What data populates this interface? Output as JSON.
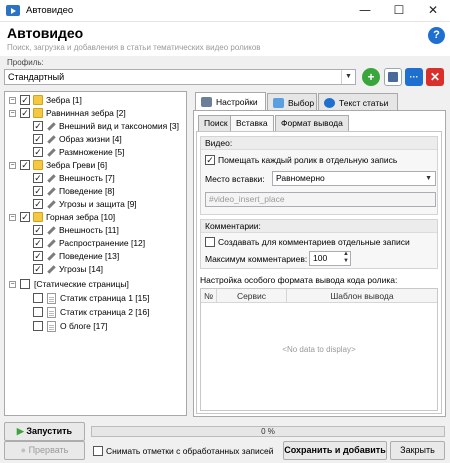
{
  "window": {
    "title": "Автовидео",
    "minimize": "—",
    "maximize": "☐",
    "close": "✕"
  },
  "header": {
    "title": "Автовидео",
    "subtitle": "Поиск, загрузка и добавления в статьи тематических видео роликов",
    "help": "?"
  },
  "profile": {
    "label": "Профиль:",
    "value": "Стандартный"
  },
  "tree": [
    {
      "label": "Зебра [1]"
    },
    {
      "label": "Равнинная зебра [2]"
    },
    {
      "label": "Внешний вид и таксономия [3]"
    },
    {
      "label": "Образ жизни [4]"
    },
    {
      "label": "Размножение [5]"
    },
    {
      "label": "Зебра Греви [6]"
    },
    {
      "label": "Внешность [7]"
    },
    {
      "label": "Поведение [8]"
    },
    {
      "label": "Угрозы и защита [9]"
    },
    {
      "label": "Горная зебра [10]"
    },
    {
      "label": "Внешность [11]"
    },
    {
      "label": "Распространение [12]"
    },
    {
      "label": "Поведение [13]"
    },
    {
      "label": "Угрозы [14]"
    },
    {
      "label": "[Статические страницы]"
    },
    {
      "label": "Статик страница 1 [15]"
    },
    {
      "label": "Статик страница 2 [16]"
    },
    {
      "label": "О блоге [17]"
    }
  ],
  "tabs": {
    "settings": "Настройки",
    "select": "Выбор",
    "article_text": "Текст статьи"
  },
  "subtabs": {
    "search": "Поиск",
    "insert": "Вставка",
    "output_format": "Формат вывода"
  },
  "video": {
    "group_label": "Видео:",
    "separate_entry_label": "Помещать каждый ролик в отдельную запись",
    "insert_place_label": "Место вставки:",
    "insert_place_value": "Равномерно",
    "insert_placeholder": "#video_insert_place"
  },
  "comments": {
    "group_label": "Комментарии:",
    "separate_entries_label": "Создавать для комментариев отдельные записи",
    "max_label": "Максимум комментариев:",
    "max_value": "100"
  },
  "format": {
    "label": "Настройка особого формата вывода кода ролика:",
    "columns": [
      "№",
      "Сервис",
      "Шаблон вывода"
    ],
    "empty": "<No data to display>"
  },
  "bottom": {
    "start": "Запустить",
    "stop": "Прервать",
    "progress": "0 %",
    "progress_value": 0,
    "uncheck_processed": "Снимать отметки с обработанных записей",
    "save_add": "Сохранить и добавить",
    "close": "Закрыть"
  },
  "colors": {
    "accent": "#1f6fd1",
    "green": "#3aa53a",
    "red": "#d9302b",
    "folder": "#f5c842"
  }
}
